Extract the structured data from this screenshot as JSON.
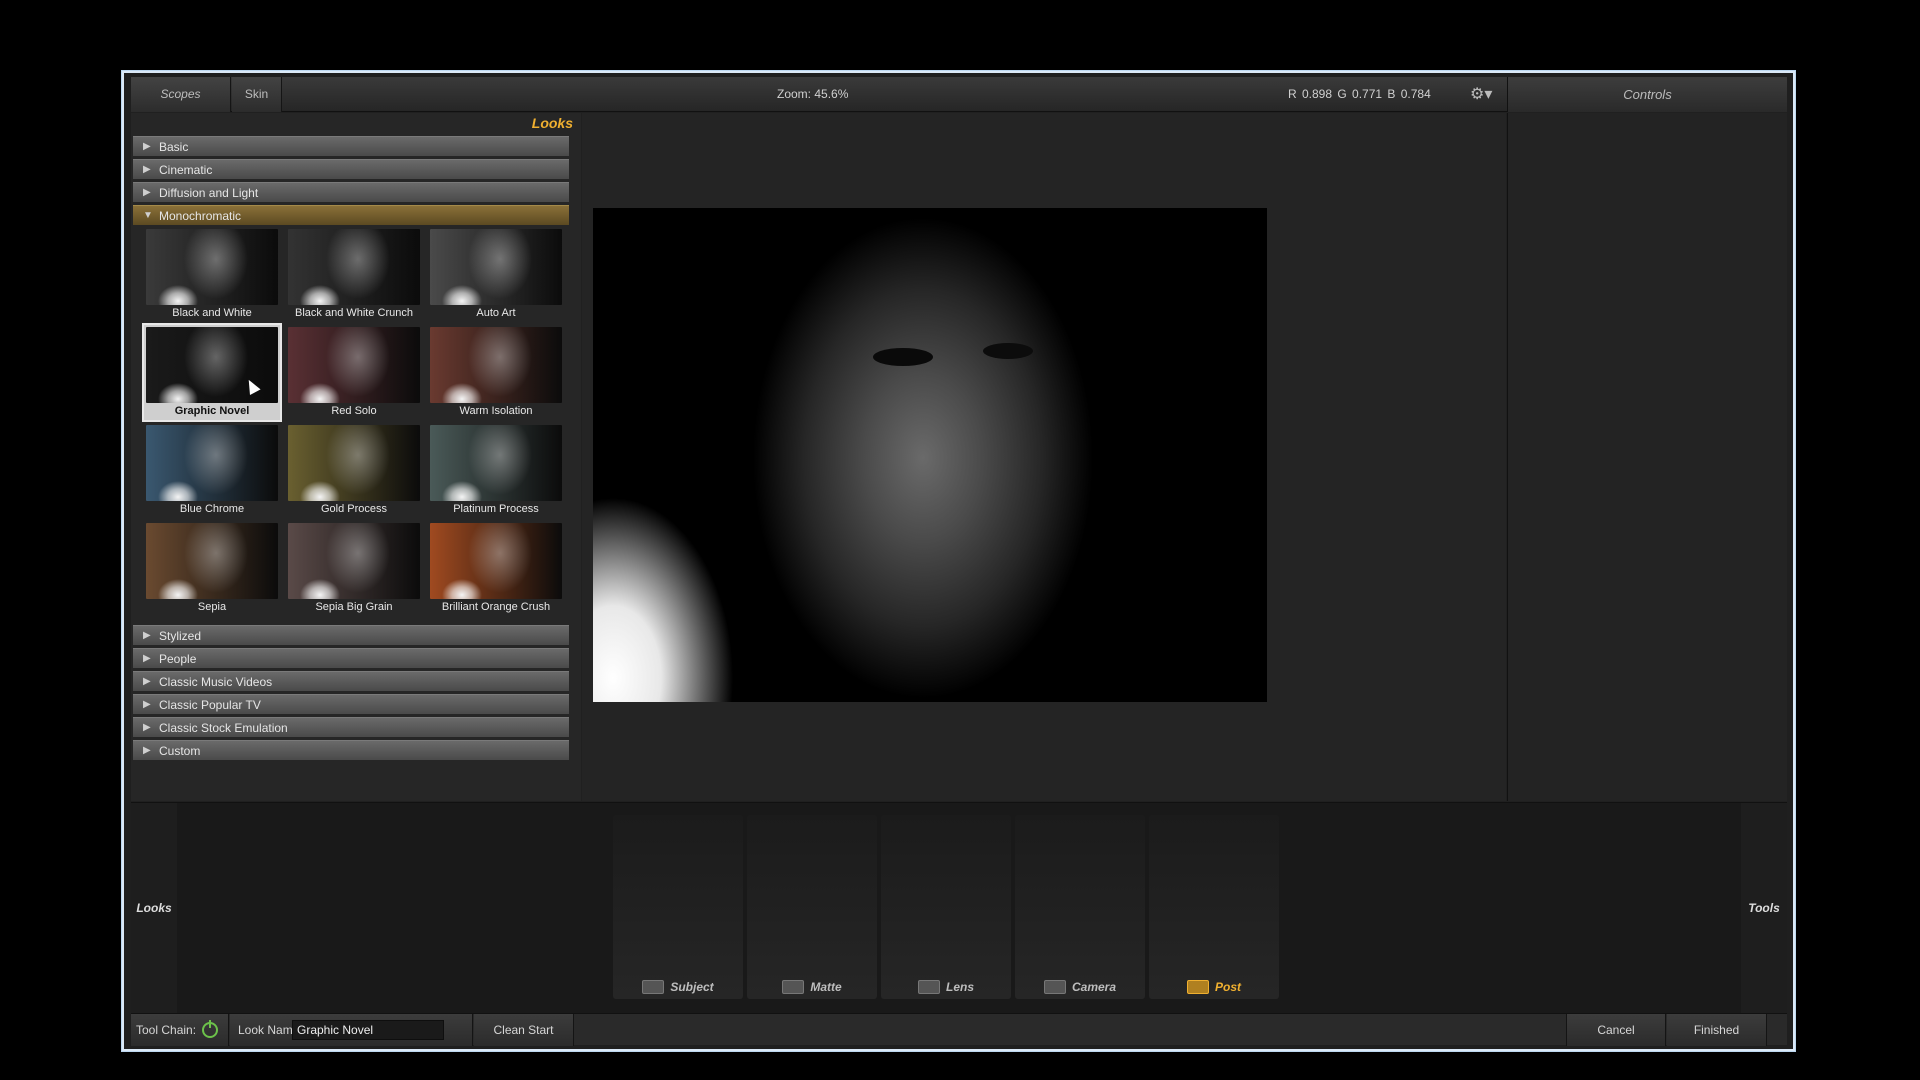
{
  "toolbar": {
    "scopes": "Scopes",
    "skin": "Skin",
    "zoom_label": "Zoom:",
    "zoom_value": "45.6%",
    "rgb": "R 0.898   G 0.771   B 0.784",
    "controls": "Controls"
  },
  "looks": {
    "title": "Looks",
    "categories": [
      {
        "label": "Basic",
        "open": false
      },
      {
        "label": "Cinematic",
        "open": false
      },
      {
        "label": "Diffusion and Light",
        "open": false
      },
      {
        "label": "Monochromatic",
        "open": true
      },
      {
        "label": "Stylized",
        "open": false
      },
      {
        "label": "People",
        "open": false
      },
      {
        "label": "Classic Music Videos",
        "open": false
      },
      {
        "label": "Classic Popular TV",
        "open": false
      },
      {
        "label": "Classic Stock Emulation",
        "open": false
      },
      {
        "label": "Custom",
        "open": false
      }
    ],
    "presets": [
      {
        "label": "Black and White",
        "tint": "#3a3a3a",
        "selected": false
      },
      {
        "label": "Black and White Crunch",
        "tint": "#333333",
        "selected": false
      },
      {
        "label": "Auto Art",
        "tint": "#4a4a4a",
        "selected": false
      },
      {
        "label": "Graphic Novel",
        "tint": "#1a1a1a",
        "selected": true
      },
      {
        "label": "Red Solo",
        "tint": "#5a3034",
        "selected": false
      },
      {
        "label": "Warm Isolation",
        "tint": "#6a3a30",
        "selected": false
      },
      {
        "label": "Blue Chrome",
        "tint": "#3a5870",
        "selected": false
      },
      {
        "label": "Gold Process",
        "tint": "#6a6030",
        "selected": false
      },
      {
        "label": "Platinum Process",
        "tint": "#4a5a58",
        "selected": false
      },
      {
        "label": "Sepia",
        "tint": "#6a4a30",
        "selected": false
      },
      {
        "label": "Sepia Big Grain",
        "tint": "#5a4a48",
        "selected": false
      },
      {
        "label": "Brilliant Orange Crush",
        "tint": "#a04a20",
        "selected": false
      }
    ]
  },
  "side": {
    "looks": "Looks",
    "tools": "Tools"
  },
  "tools": [
    {
      "label": "Subject",
      "active": false
    },
    {
      "label": "Matte",
      "active": false
    },
    {
      "label": "Lens",
      "active": false
    },
    {
      "label": "Camera",
      "active": false
    },
    {
      "label": "Post",
      "active": true
    }
  ],
  "status": {
    "tool_chain": "Tool Chain:",
    "look_name_label": "Look Name:",
    "look_name_value": "Graphic Novel",
    "clean_start": "Clean Start",
    "cancel": "Cancel",
    "finished": "Finished"
  },
  "colors": {
    "accent": "#f0b030",
    "power": "#6cc24a"
  }
}
